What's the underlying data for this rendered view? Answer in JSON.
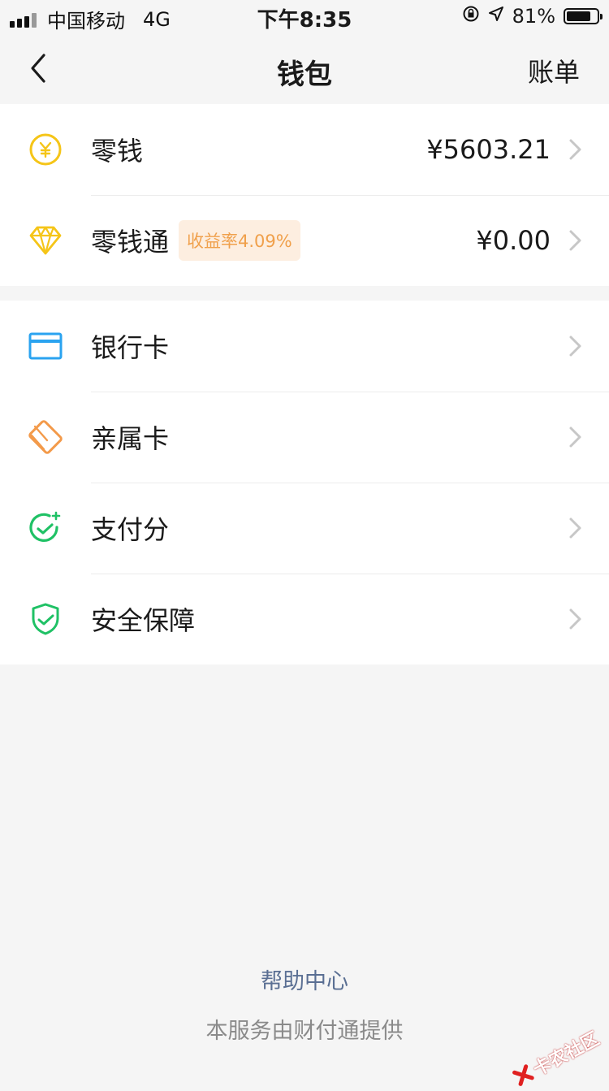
{
  "status_bar": {
    "carrier": "中国移动",
    "network": "4G",
    "time": "下午8:35",
    "battery_percent": "81%",
    "battery_level": 0.81
  },
  "nav": {
    "title": "钱包",
    "right_action": "账单"
  },
  "wallet": {
    "change": {
      "label": "零钱",
      "value": "¥5603.21",
      "icon": "yuan-coin-icon"
    },
    "savings": {
      "label": "零钱通",
      "badge": "收益率4.09%",
      "value": "¥0.00",
      "icon": "diamond-icon"
    }
  },
  "services": [
    {
      "label": "银行卡",
      "icon": "bank-card-icon"
    },
    {
      "label": "亲属卡",
      "icon": "family-card-icon"
    },
    {
      "label": "支付分",
      "icon": "payscore-icon"
    },
    {
      "label": "安全保障",
      "icon": "shield-check-icon"
    }
  ],
  "footer": {
    "help": "帮助中心",
    "provider": "本服务由财付通提供"
  },
  "watermark": "卡农社区",
  "colors": {
    "background": "#f5f5f5",
    "yellow": "#f5c518",
    "blue": "#2aa3f0",
    "orange": "#f39a4a",
    "green": "#1fc165",
    "link": "#5a6f93",
    "badge_text": "#f0a04b",
    "badge_bg": "#fdeee0"
  }
}
